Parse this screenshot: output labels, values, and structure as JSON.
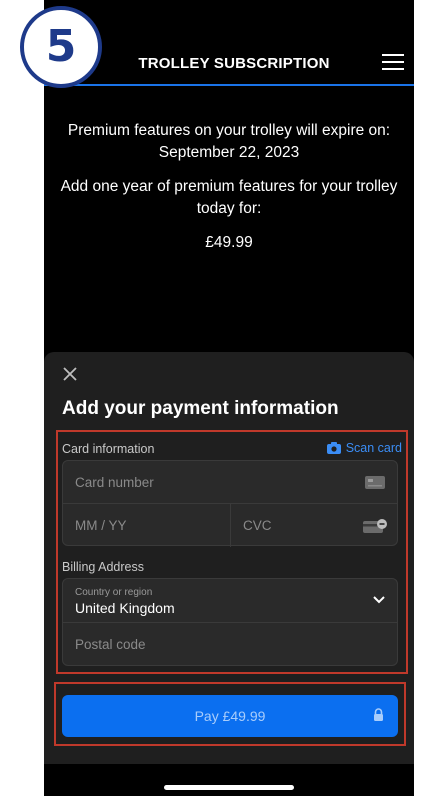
{
  "step": {
    "number": "5"
  },
  "header": {
    "title": "TROLLEY SUBSCRIPTION",
    "menu_icon": "hamburger-menu-icon"
  },
  "intro": {
    "expiry_text": "Premium features on your trolley will expire on: September 22, 2023",
    "offer_text": "Add one year of premium features for your trolley today for:",
    "price": "£49.99"
  },
  "payment_sheet": {
    "title": "Add your payment information",
    "card_info_label": "Card information",
    "scan_card_label": "Scan card",
    "card_number": {
      "placeholder": "Card number",
      "value": ""
    },
    "expiry": {
      "placeholder": "MM / YY",
      "value": ""
    },
    "cvc": {
      "placeholder": "CVC",
      "value": ""
    },
    "billing_label": "Billing Address",
    "country": {
      "label": "Country or region",
      "value": "United Kingdom"
    },
    "postal_code": {
      "placeholder": "Postal code",
      "value": ""
    },
    "pay_button_label": "Pay £49.99"
  },
  "colors": {
    "accent": "#0b6ff0",
    "highlight": "#c0392b",
    "badge": "#1e3a8a"
  }
}
